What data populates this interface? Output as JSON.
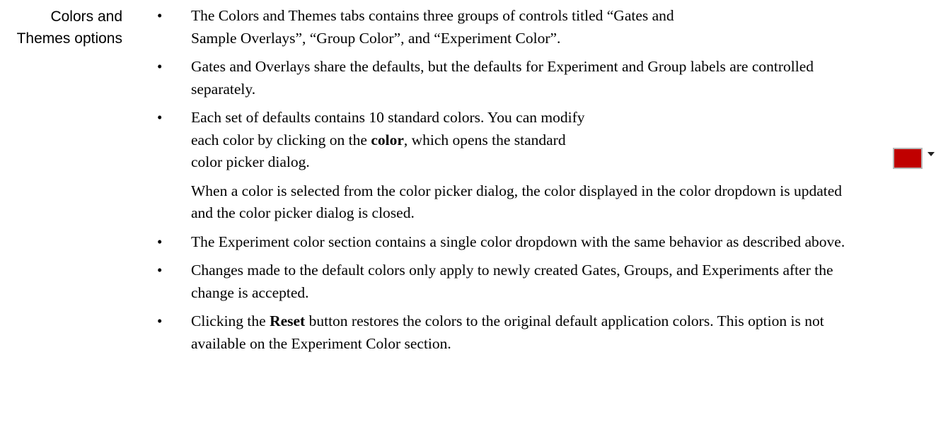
{
  "section": {
    "label": "Colors and Themes options"
  },
  "bullets": [
    {
      "text": "The Colors and Themes tabs contains three groups of controls titled “Gates and Sample Overlays”, “Group Color”, and “Experiment Color”."
    },
    {
      "text": "Gates and Overlays share the defaults, but the defaults for Experiment and Group labels are controlled separately."
    },
    {
      "pre": "Each set of defaults contains 10 standard colors. You can modify each color by clicking on the ",
      "bold": "color",
      "post": ", which opens the standard color picker dialog.",
      "followup": "When a color is selected from the color picker dialog, the color displayed in the color dropdown is updated and the color picker dialog is closed."
    },
    {
      "text": "The Experiment color section contains a single color dropdown with the same behavior as described above."
    },
    {
      "text": "Changes made to the default colors only apply to newly created Gates, Groups, and Experiments after the change is accepted."
    },
    {
      "pre": "Clicking the ",
      "bold": "Reset",
      "post": " button restores the colors to the original default application colors. This option is not available on the Experiment Color section."
    }
  ],
  "color_dropdown": {
    "swatch_color": "#c00000",
    "icon": "chevron-down-icon"
  },
  "bullet_glyph": "•"
}
